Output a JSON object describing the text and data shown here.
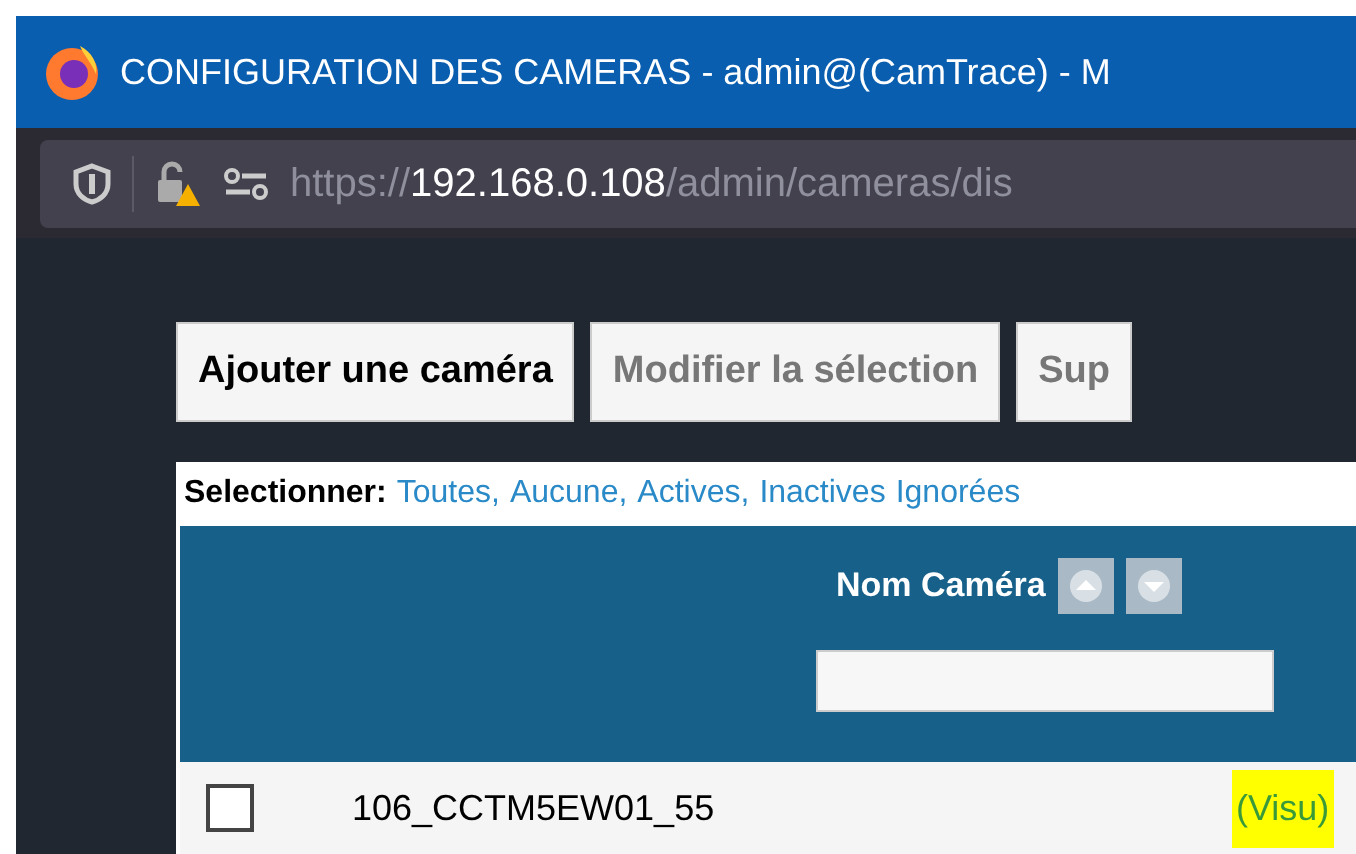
{
  "window": {
    "title": "CONFIGURATION DES CAMERAS - admin@(CamTrace) - M"
  },
  "address_bar": {
    "scheme": "https://",
    "host": "192.168.0.108",
    "path": "/admin/cameras/dis"
  },
  "buttons": [
    {
      "label": "Ajouter une caméra",
      "disabled": false
    },
    {
      "label": "Modifier la sélection",
      "disabled": true
    },
    {
      "label": "Sup",
      "disabled": true
    }
  ],
  "select_bar": {
    "label": "Selectionner:",
    "links": [
      "Toutes,",
      "Aucune,",
      "Actives,",
      "Inactives",
      "Ignorées"
    ]
  },
  "table": {
    "columns": [
      {
        "label": "Nom Caméra"
      }
    ],
    "rows": [
      {
        "checked": false,
        "name": "106_CCTM5EW01_55",
        "link": "(Visu)"
      }
    ]
  }
}
